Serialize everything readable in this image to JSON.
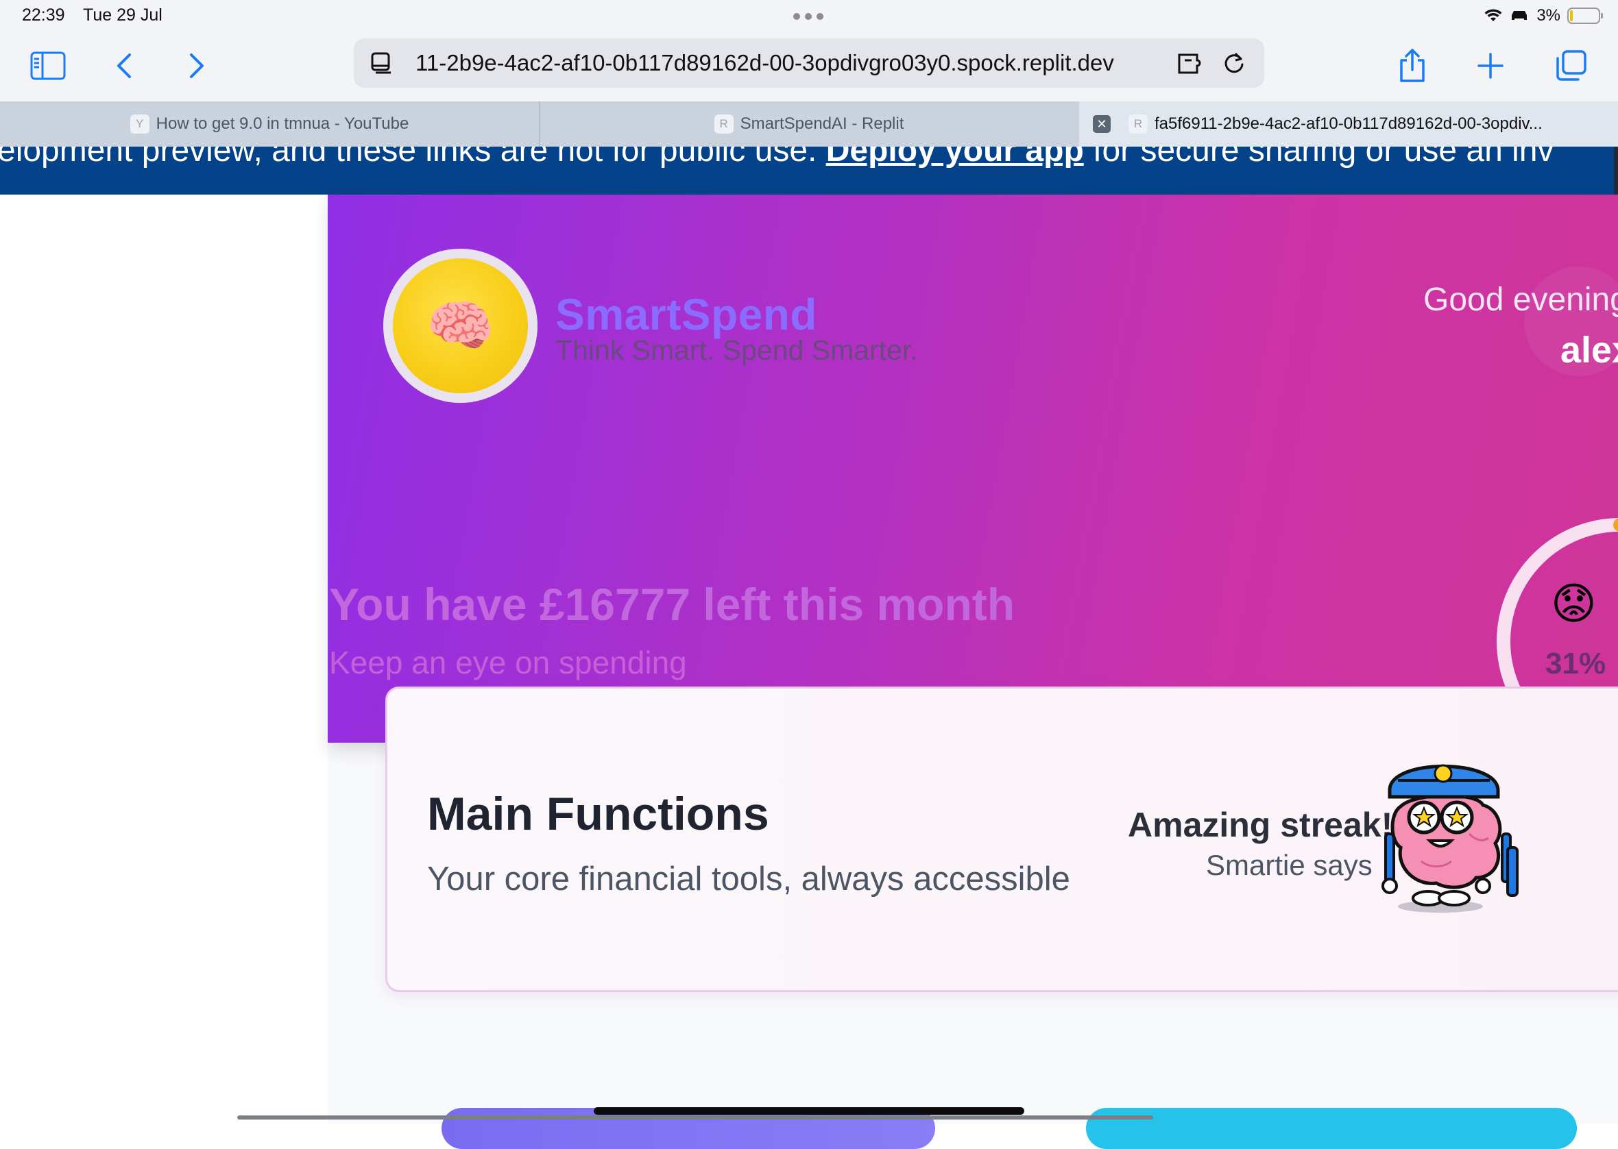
{
  "status_bar": {
    "time": "22:39",
    "date": "Tue 29 Jul",
    "battery": "3%"
  },
  "browser": {
    "url": "11-2b9e-4ac2-af10-0b117d89162d-00-3opdivgro03y0.spock.replit.dev",
    "tabs": [
      {
        "favicon": "Y",
        "title": "How to get 9.0 in tmnua - YouTube",
        "active": false
      },
      {
        "favicon": "R",
        "title": "SmartSpendAI - Replit",
        "active": false
      },
      {
        "favicon": "R",
        "title": "fa5f6911-2b9e-4ac2-af10-0b117d89162d-00-3opdiv...",
        "active": true
      }
    ],
    "close_label": "✕"
  },
  "banner": {
    "text_before": "elopment preview, and these links are not for public use.",
    "link": "Deploy your app",
    "text_after": "for secure sharing or use an inv"
  },
  "hero": {
    "logo_emoji": "🧠",
    "brand": "SmartSpend",
    "tagline": "Think Smart. Spend Smarter.",
    "greeting": "Good evening",
    "user_name": "alex",
    "remaining_message": "You have £16777 left this month",
    "advice": "Keep an eye on spending",
    "gauge": {
      "emoji": "😟",
      "percent_label": "31%",
      "percent": 31,
      "color": "#f5a31a"
    }
  },
  "main_card": {
    "title": "Main Functions",
    "subtitle": "Your core financial tools, always accessible",
    "streak_text": "Amazing streak!",
    "speaker": "Smartie says"
  },
  "colors": {
    "banner": "#044389",
    "hero_start": "#8f2fe6",
    "hero_end": "#cf3598",
    "accent_blue": "#1a7cf2"
  }
}
